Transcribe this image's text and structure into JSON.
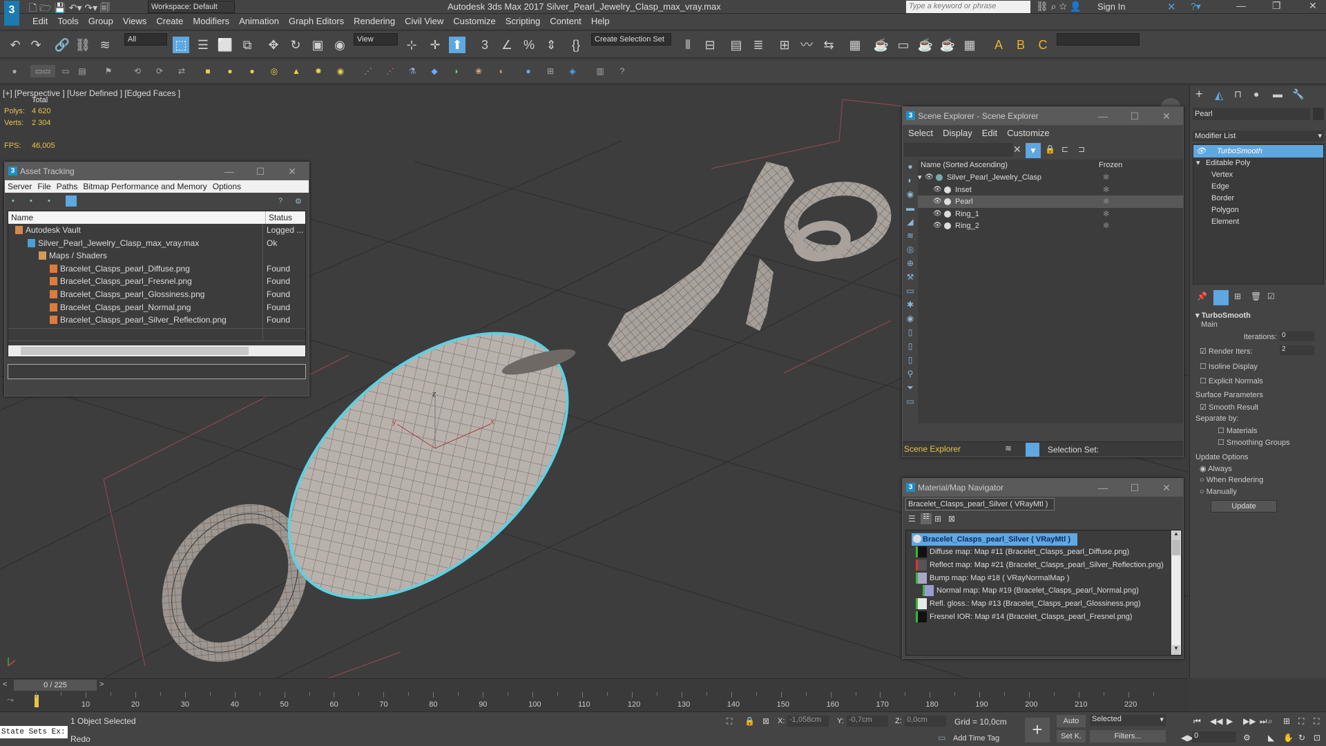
{
  "titlebar": {
    "workspace": "Workspace: Default",
    "title": "Autodesk 3ds Max 2017     Silver_Pearl_Jewelry_Clasp_max_vray.max",
    "search_placeholder": "Type a keyword or phrase",
    "signin": "Sign In"
  },
  "menu": [
    "Edit",
    "Tools",
    "Group",
    "Views",
    "Create",
    "Modifiers",
    "Animation",
    "Graph Editors",
    "Rendering",
    "Civil View",
    "Customize",
    "Scripting",
    "Content",
    "Help"
  ],
  "toolbar": {
    "filter": "All",
    "view": "View",
    "selection_set": "Create Selection Set"
  },
  "viewport": {
    "label": "[+] [Perspective ] [User Defined ] [Edged Faces ]",
    "stats_total": "Total",
    "polys_label": "Polys:",
    "polys": "4 620",
    "verts_label": "Verts:",
    "verts": "2 304",
    "fps_label": "FPS:",
    "fps": "46,005"
  },
  "asset_tracking": {
    "title": "Asset Tracking",
    "menu": [
      "Server",
      "File",
      "Paths",
      "Bitmap Performance and Memory",
      "Options"
    ],
    "col_name": "Name",
    "col_status": "Status",
    "rows": [
      {
        "name": "Autodesk Vault",
        "status": "Logged ..."
      },
      {
        "name": "Silver_Pearl_Jewelry_Clasp_max_vray.max",
        "status": "Ok"
      },
      {
        "name": "Maps / Shaders",
        "status": ""
      },
      {
        "name": "Bracelet_Clasps_pearl_Diffuse.png",
        "status": "Found"
      },
      {
        "name": "Bracelet_Clasps_pearl_Fresnel.png",
        "status": "Found"
      },
      {
        "name": "Bracelet_Clasps_pearl_Glossiness.png",
        "status": "Found"
      },
      {
        "name": "Bracelet_Clasps_pearl_Normal.png",
        "status": "Found"
      },
      {
        "name": "Bracelet_Clasps_pearl_Silver_Reflection.png",
        "status": "Found"
      }
    ]
  },
  "scene_explorer": {
    "title": "Scene Explorer - Scene Explorer",
    "menu": [
      "Select",
      "Display",
      "Edit",
      "Customize"
    ],
    "col_name": "Name (Sorted Ascending)",
    "col_frozen": "Frozen",
    "items": [
      {
        "name": "Silver_Pearl_Jewelry_Clasp",
        "level": 0
      },
      {
        "name": "Inset",
        "level": 1
      },
      {
        "name": "Pearl",
        "level": 1
      },
      {
        "name": "Ring_1",
        "level": 1
      },
      {
        "name": "Ring_2",
        "level": 1
      }
    ],
    "footer_label": "Scene Explorer",
    "selection_set": "Selection Set:"
  },
  "material_nav": {
    "title": "Material/Map Navigator",
    "current": "Bracelet_Clasps_pearl_Silver  ( VRayMtl )",
    "root": "Bracelet_Clasps_pearl_Silver  ( VRayMtl )",
    "maps": [
      "Diffuse map: Map #11 (Bracelet_Clasps_pearl_Diffuse.png)",
      "Reflect map: Map #21 (Bracelet_Clasps_pearl_Silver_Reflection.png)",
      "Bump map: Map #18  ( VRayNormalMap )",
      "Normal map: Map #19 (Bracelet_Clasps_pearl_Normal.png)",
      "Refl. gloss.: Map #13 (Bracelet_Clasps_pearl_Glossiness.png)",
      "Fresnel IOR: Map #14 (Bracelet_Clasps_pearl_Fresnel.png)"
    ]
  },
  "command_panel": {
    "object_name": "Pearl",
    "modifier_list": "Modifier List",
    "stack": [
      "TurboSmooth",
      "Editable Poly",
      "Vertex",
      "Edge",
      "Border",
      "Polygon",
      "Element"
    ],
    "rollout": "TurboSmooth",
    "main": "Main",
    "iterations_label": "Iterations:",
    "iterations": "0",
    "render_iters_label": "Render Iters:",
    "render_iters": "2",
    "isoline": "Isoline Display",
    "explicit": "Explicit Normals",
    "surface": "Surface Parameters",
    "smooth": "Smooth Result",
    "separate": "Separate by:",
    "materials": "Materials",
    "smoothing": "Smoothing Groups",
    "update_opts": "Update Options",
    "always": "Always",
    "when_rendering": "When Rendering",
    "manually": "Manually",
    "update_btn": "Update"
  },
  "timeline": {
    "frame": "0 / 225",
    "ticks": [
      "10",
      "20",
      "30",
      "40",
      "50",
      "60",
      "70",
      "80",
      "90",
      "100",
      "110",
      "120",
      "130",
      "140",
      "150",
      "160",
      "170",
      "180",
      "190",
      "200",
      "210",
      "220"
    ]
  },
  "status": {
    "selected": "1 Object Selected",
    "redo": "Redo",
    "state_sets": "State Sets Ex:",
    "x_label": "X:",
    "x": "-1,058cm",
    "y_label": "Y:",
    "y": "-0,7cm",
    "z_label": "Z:",
    "z": "0,0cm",
    "grid": "Grid = 10,0cm",
    "add_time_tag": "Add Time Tag",
    "auto": "Auto",
    "set_k": "Set K.",
    "selected_dd": "Selected",
    "filters": "Filters...",
    "frame_val": "0"
  }
}
